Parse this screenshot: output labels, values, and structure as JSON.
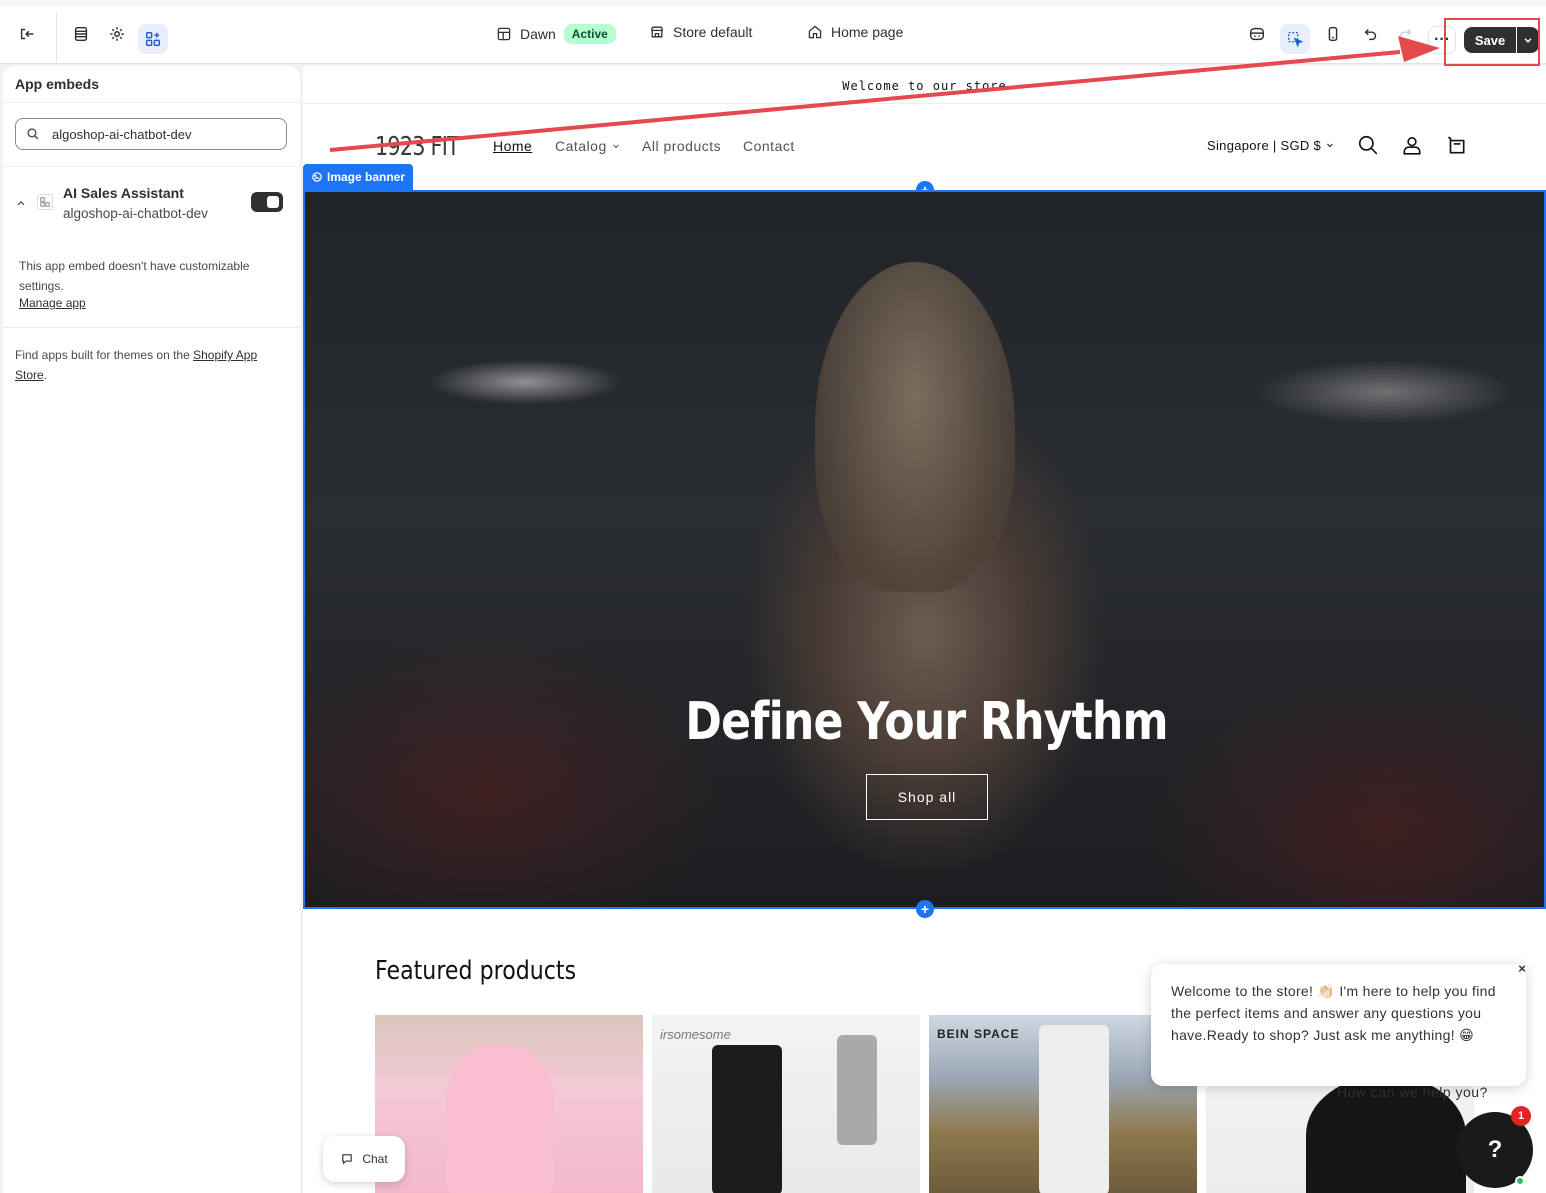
{
  "topbar": {
    "theme_name": "Dawn",
    "theme_status": "Active",
    "context": "Store default",
    "page": "Home page",
    "save_label": "Save",
    "more_label": "···"
  },
  "sidebar": {
    "title": "App embeds",
    "search_value": "algoshop-ai-chatbot-dev",
    "embed_name": "AI Sales Assistant",
    "embed_app": "algoshop-ai-chatbot-dev",
    "embed_enabled": true,
    "no_settings_text": "This app embed doesn't have customizable settings.",
    "manage_link": "Manage app",
    "find_text_prefix": "Find apps built for themes on the ",
    "find_link": "Shopify App Store",
    "find_text_suffix": "."
  },
  "store": {
    "announcement": "Welcome to our store",
    "logo": "1923 FIT",
    "nav": [
      "Home",
      "Catalog",
      "All products",
      "Contact"
    ],
    "locale": "Singapore | SGD $",
    "section_tag": "Image banner",
    "hero_title": "Define Your Rhythm",
    "hero_button": "Shop all",
    "featured_title": "Featured products",
    "product_brands": [
      "",
      "irsomesome",
      "BEIN SPACE",
      ""
    ],
    "chat_pill_label": "Chat"
  },
  "chatbot": {
    "welcome_message": "Welcome to the store! 👏🏻 I'm here to help you find the perfect items and answer any questions you have.Ready to shop? Just ask me anything! 😁",
    "help_prompt": "How can we help you?",
    "help_button": "?",
    "unread_count": "1",
    "close_label": "×"
  },
  "colors": {
    "accent_blue": "#1d74f5",
    "active_badge_bg": "#b4fed2",
    "save_bg": "#303030",
    "annotation_red": "#e5484d"
  }
}
